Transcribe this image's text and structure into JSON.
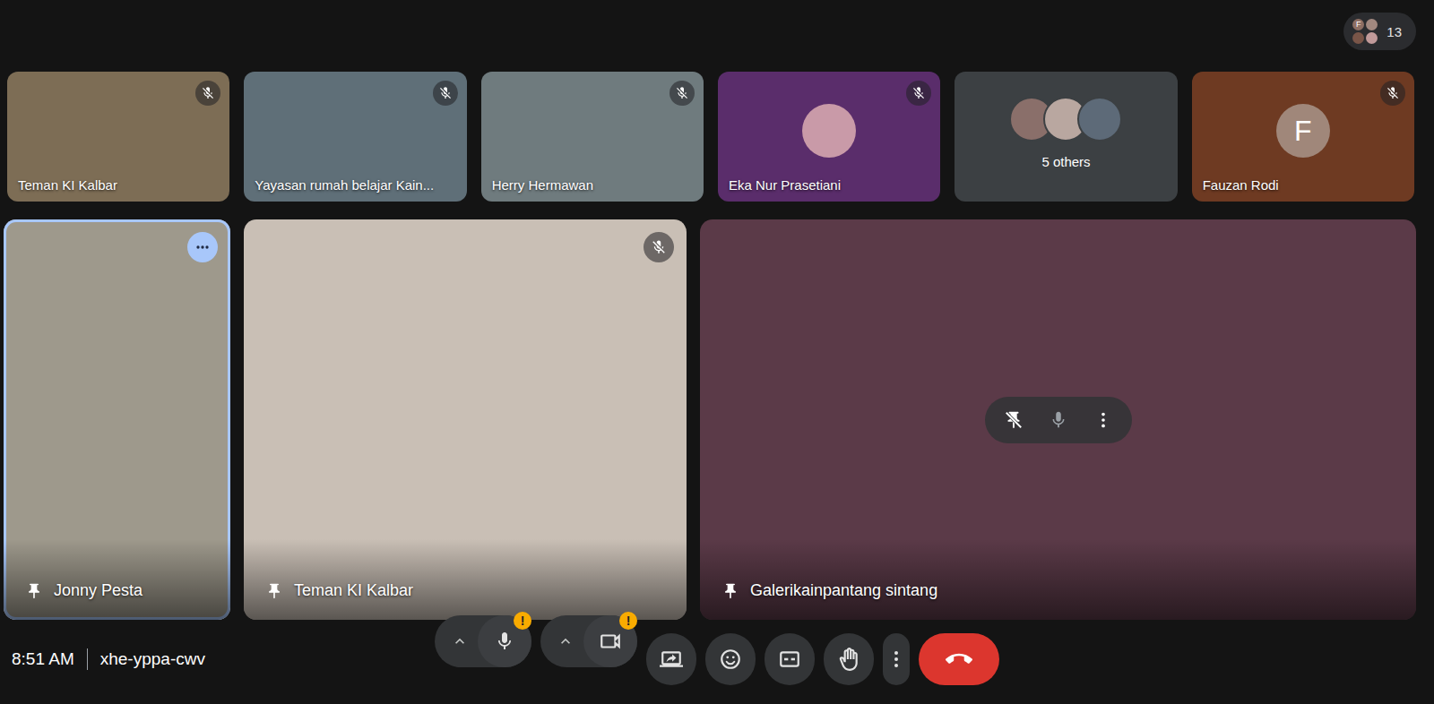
{
  "participants_chip": {
    "count": "13",
    "avatars": [
      "F",
      "",
      "",
      ""
    ]
  },
  "top_tiles": [
    {
      "name": "Teman KI Kalbar",
      "kind": "video",
      "muted": true,
      "color": "#7d6d55"
    },
    {
      "name": "Yayasan rumah belajar Kain...",
      "kind": "video",
      "muted": true,
      "color": "#5f6f78"
    },
    {
      "name": "Herry Hermawan",
      "kind": "video",
      "muted": true,
      "color": "#6f7b7e"
    },
    {
      "name": "Eka Nur Prasetiani",
      "kind": "avatar",
      "initial": "",
      "muted": true,
      "color": "#5a2d6b"
    },
    {
      "name": "5 others",
      "kind": "others",
      "initial": "",
      "muted": false,
      "color": "#3c4043"
    },
    {
      "name": "Fauzan Rodi",
      "kind": "initial",
      "initial": "F",
      "muted": true,
      "color": "#6e3a22"
    }
  ],
  "main_tiles": [
    {
      "name": "Jonny Pesta",
      "pinned": true,
      "muted": false,
      "focused": true,
      "hovered": false,
      "color": "#9e998c"
    },
    {
      "name": "Teman KI Kalbar",
      "pinned": true,
      "muted": true,
      "focused": false,
      "hovered": false,
      "color": "#c9bfb5"
    },
    {
      "name": "Galerikainpantang sintang",
      "pinned": true,
      "muted": false,
      "focused": false,
      "hovered": true,
      "color": "#5b3a48"
    }
  ],
  "meeting": {
    "time": "8:51 AM",
    "code": "xhe-yppa-cwv"
  },
  "controls": [
    {
      "kind": "mic",
      "chevron": true,
      "badge": "!"
    },
    {
      "kind": "camera",
      "chevron": true,
      "badge": "!"
    },
    {
      "kind": "present",
      "chevron": false,
      "badge": ""
    },
    {
      "kind": "emoji",
      "chevron": false,
      "badge": ""
    },
    {
      "kind": "captions",
      "chevron": false,
      "badge": ""
    },
    {
      "kind": "hand",
      "chevron": false,
      "badge": ""
    },
    {
      "kind": "more",
      "chevron": false,
      "badge": ""
    },
    {
      "kind": "leave",
      "chevron": false,
      "badge": ""
    }
  ]
}
